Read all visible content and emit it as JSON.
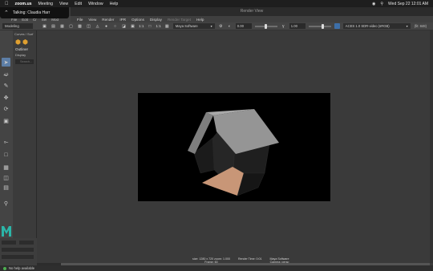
{
  "mac_menubar": {
    "app": "zoom.us",
    "items": [
      "Meeting",
      "View",
      "Edit",
      "Window",
      "Help"
    ],
    "clock": "Wed Sep 22  12:01 AM"
  },
  "zoom_overlay": {
    "talking": "Talking: Claudia Harr"
  },
  "maya_menu": [
    "File",
    "Edit",
    "Cr",
    "Sel",
    "Mod"
  ],
  "render_view": {
    "window_title": "Render View",
    "menu": [
      {
        "label": "File",
        "dim": false
      },
      {
        "label": "View",
        "dim": false
      },
      {
        "label": "Render",
        "dim": false
      },
      {
        "label": "IPR",
        "dim": false
      },
      {
        "label": "Options",
        "dim": false
      },
      {
        "label": "Display",
        "dim": false
      },
      {
        "label": "Render Target",
        "dim": true
      },
      {
        "label": "Help",
        "dim": false
      }
    ],
    "toolbar": {
      "ratio_label": "1:1",
      "ratio_left": "1:1",
      "renderer": "Maya Software",
      "exposure": "0.00",
      "gamma": "1.00",
      "view_transform": "ACES 1.0 SDR-video (sRGB)",
      "size_info": "(fit: 848)"
    },
    "render_info": {
      "col1": [
        "size: 1280 x 720  zoom: 1.000",
        "Frame: 60"
      ],
      "col2": [
        "",
        "Render Time: 0:01"
      ],
      "col3": [
        "Maya Software",
        "Camera: persp"
      ]
    },
    "scene": {
      "roof_color": "#8f8f8f",
      "wall_color": "#1e1e1e",
      "floor_color": "#c89677",
      "background": "#000000"
    }
  },
  "maya_ui": {
    "mode": "Modeling",
    "shelf_tab": "Curves / Surf",
    "outliner_title": "Outliner",
    "outliner_display": "Display",
    "search_placeholder": "Search...",
    "help_text": "No help available"
  },
  "colors": {
    "accent": "#5d7ea6",
    "maya_logo": "#2bb5a8"
  }
}
